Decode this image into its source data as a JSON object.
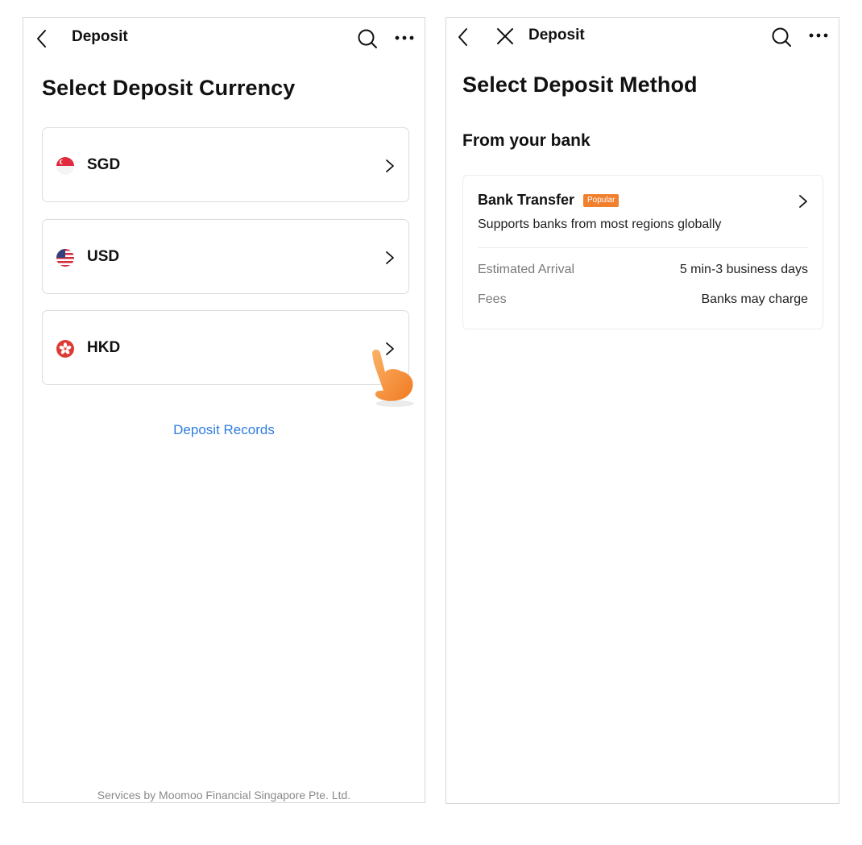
{
  "left_screen": {
    "nav": {
      "title": "Deposit"
    },
    "page_title": "Select Deposit Currency",
    "currencies": [
      {
        "code": "SGD",
        "flag_icon": "singapore-flag-icon"
      },
      {
        "code": "USD",
        "flag_icon": "us-flag-icon"
      },
      {
        "code": "HKD",
        "flag_icon": "hong-kong-flag-icon"
      }
    ],
    "records_link": "Deposit Records",
    "footer": "Services by Moomoo Financial Singapore Pte. Ltd."
  },
  "right_screen": {
    "nav": {
      "title": "Deposit"
    },
    "page_title": "Select Deposit Method",
    "section_title": "From your bank",
    "method": {
      "title": "Bank Transfer",
      "badge": "Popular",
      "description": "Supports banks from most regions globally",
      "rows": [
        {
          "label": "Estimated Arrival",
          "value": "5 min-3 business days"
        },
        {
          "label": "Fees",
          "value": "Banks may charge"
        }
      ]
    }
  },
  "colors": {
    "link": "#2f7de1",
    "badge": "#f0802e",
    "pointer_hand": "#f7923a"
  }
}
